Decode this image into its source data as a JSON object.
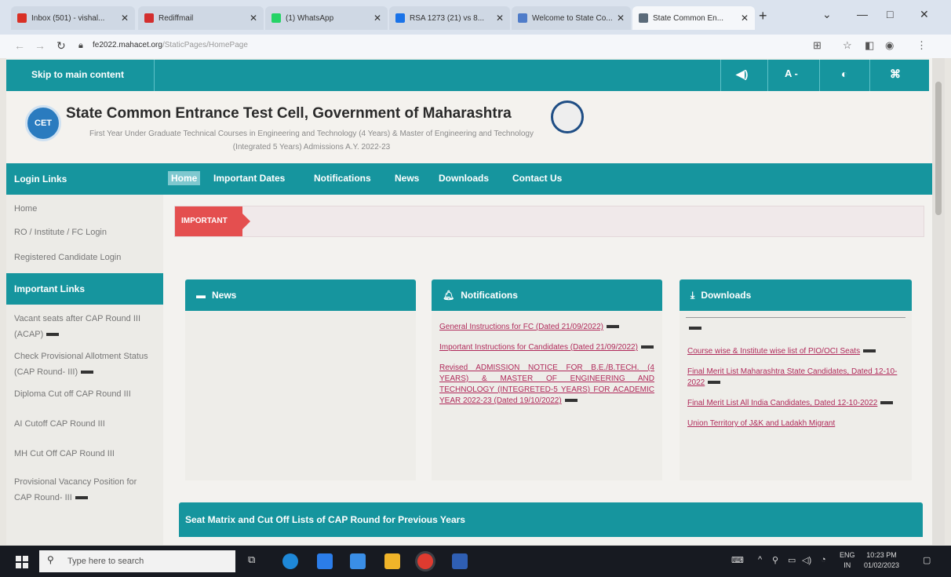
{
  "browser": {
    "tabs": [
      {
        "label": "Inbox (501) - vishal...",
        "color": "#d93025"
      },
      {
        "label": "Rediffmail",
        "color": "#d32f2f"
      },
      {
        "label": "(1) WhatsApp",
        "color": "#25d366"
      },
      {
        "label": "RSA 1273 (21) vs 8...",
        "color": "#1a73e8"
      },
      {
        "label": "Welcome to State Co...",
        "color": "#4f7cc9"
      },
      {
        "label": "State Common En...",
        "color": "#5b6b7a"
      }
    ],
    "new_tab": "+",
    "url_host": "fe2022.mahacet.org",
    "url_path": "/StaticPages/HomePage"
  },
  "page": {
    "skip_link": "Skip to main content",
    "accessibility": {
      "speaker": "◀)",
      "font": "A -",
      "contrast": "◐",
      "sitemap": "⌘"
    },
    "header": {
      "logo_text": "CET",
      "title": "State Common Entrance Test Cell, Government of Maharashtra",
      "subtitle": "First Year Under Graduate Technical Courses in Engineering and Technology (4 Years) & Master of Engineering and Technology (Integrated 5 Years) Admissions A.Y. 2022-23"
    },
    "left_nav": {
      "login_heading": "Login Links",
      "login_items": [
        "Home",
        "RO / Institute / FC Login",
        "Registered Candidate Login"
      ],
      "important_heading": "Important Links",
      "important_items": [
        "Vacant seats after CAP Round III (ACAP)",
        "Check Provisional Allotment Status (CAP Round- III)",
        "Diploma Cut off CAP Round III",
        "AI Cutoff CAP Round III",
        "MH Cut Off CAP Round III",
        "Provisional Vacancy Position for CAP Round- III"
      ]
    },
    "main_nav": [
      "Home",
      "Important Dates",
      "Notifications",
      "News",
      "Downloads",
      "Contact Us"
    ],
    "important_tag": "IMPORTANT",
    "cards": {
      "news": {
        "title": "News"
      },
      "notifications": {
        "title": "Notifications",
        "links": [
          "General Instructions for FC (Dated 21/09/2022)",
          "Important Instructions for Candidates (Dated 21/09/2022)",
          "Revised ADMISSION NOTICE FOR B.E./B.TECH. (4 YEARS) & MASTER OF ENGINEERING AND TECHNOLOGY (INTEGRETED-5 YEARS) FOR ACADEMIC YEAR 2022-23 (Dated 19/10/2022)"
        ]
      },
      "downloads": {
        "title": "Downloads",
        "links": [
          "Course wise & Institute wise list of PIO/OCI Seats",
          "Final Merit List Maharashtra State Candidates, Dated 12-10-2022",
          "Final Merit List All India Candidates, Dated 12-10-2022",
          "Union Territory of J&K and Ladakh Migrant"
        ]
      }
    },
    "seat_matrix": "Seat Matrix and Cut Off Lists of CAP Round for Previous Years"
  },
  "taskbar": {
    "search_placeholder": "Type here to search",
    "lang_top": "ENG",
    "lang_bottom": "IN",
    "time": "10:23 PM",
    "date": "01/02/2023"
  }
}
